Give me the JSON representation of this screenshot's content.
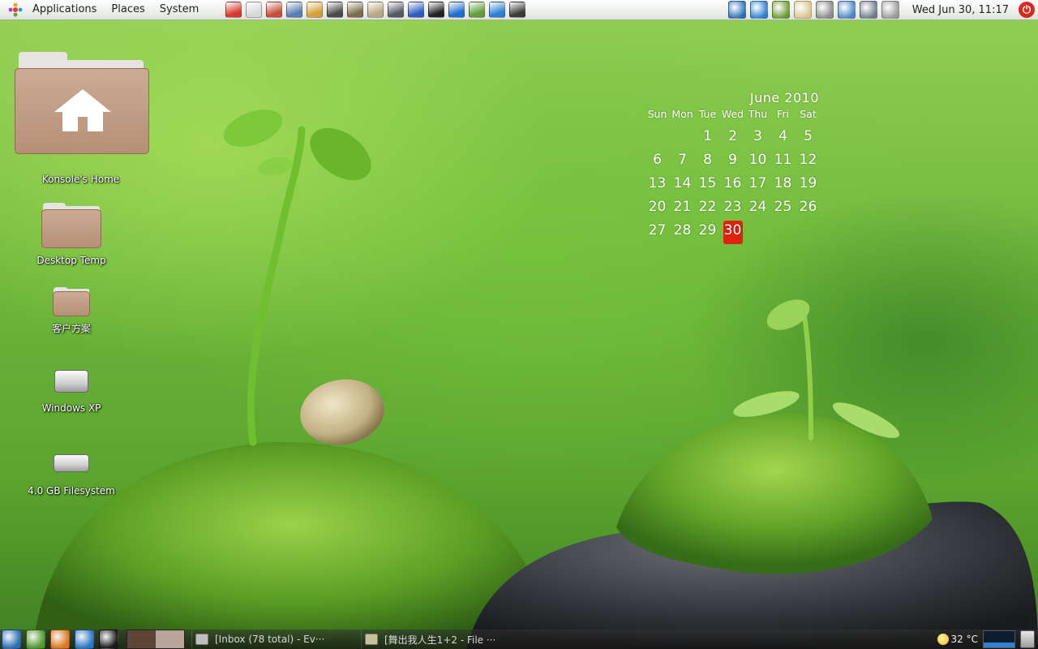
{
  "top_panel": {
    "menus": [
      "Applications",
      "Places",
      "System"
    ],
    "launcher_icons": [
      {
        "name": "mail-send-icon",
        "color": "#d63b2b"
      },
      {
        "name": "sticky-notes-icon",
        "color": "#d9d9d9"
      },
      {
        "name": "mail-client-icon",
        "color": "#c7503a"
      },
      {
        "name": "document-viewer-icon",
        "color": "#5b7db5"
      },
      {
        "name": "tools-icon",
        "color": "#d6a03a"
      },
      {
        "name": "camera-icon",
        "color": "#4a4a4a"
      },
      {
        "name": "gimp-icon",
        "color": "#7b6e4f"
      },
      {
        "name": "image-viewer-icon",
        "color": "#b9a783"
      },
      {
        "name": "calculator-icon",
        "color": "#55595f"
      },
      {
        "name": "presentation-icon",
        "color": "#2f5ec2"
      },
      {
        "name": "qq-penguin-icon",
        "color": "#222222"
      },
      {
        "name": "web-browser-globe-icon",
        "color": "#1f6fcf"
      },
      {
        "name": "network-sphere-icon",
        "color": "#5f9e3a"
      },
      {
        "name": "water-drop-icon",
        "color": "#2a7fd3"
      },
      {
        "name": "monitor-icon",
        "color": "#3b3b3b"
      }
    ],
    "tray_icons": [
      {
        "name": "download-swirl-icon",
        "color": "#2a6fb5"
      },
      {
        "name": "water-drop-tray-icon",
        "color": "#2a7fd3"
      },
      {
        "name": "globe-tray-icon",
        "color": "#6a9a2f"
      },
      {
        "name": "clipboard-icon",
        "color": "#d9c58a"
      },
      {
        "name": "volume-muted-icon",
        "color": "#8a8a8a"
      },
      {
        "name": "screenshot-icon",
        "color": "#4d86c6"
      },
      {
        "name": "network-computers-icon",
        "color": "#6e7c8a"
      },
      {
        "name": "mail-envelope-icon",
        "color": "#9a9a9a"
      }
    ],
    "clock": "Wed Jun 30, 11:17"
  },
  "desktop": {
    "icons": [
      {
        "label": "Konsole's Home",
        "kind": "home-folder"
      },
      {
        "label": "Desktop Temp",
        "kind": "folder"
      },
      {
        "label": "客户方案",
        "kind": "folder"
      },
      {
        "label": "Windows XP",
        "kind": "drive"
      },
      {
        "label": "4.0 GB Filesystem",
        "kind": "drive"
      }
    ]
  },
  "calendar": {
    "title": "June 2010",
    "weekdays": [
      "Sun",
      "Mon",
      "Tue",
      "Wed",
      "Thu",
      "Fri",
      "Sat"
    ],
    "leading_blank_days": 2,
    "days": [
      "1",
      "2",
      "3",
      "4",
      "5",
      "6",
      "7",
      "8",
      "9",
      "10",
      "11",
      "12",
      "13",
      "14",
      "15",
      "16",
      "17",
      "18",
      "19",
      "20",
      "21",
      "22",
      "23",
      "24",
      "25",
      "26",
      "27",
      "28",
      "29",
      "30"
    ],
    "today": "30",
    "today_color": "#e0220f"
  },
  "bottom_panel": {
    "launcher_icons": [
      {
        "name": "swirl-logo-icon",
        "color": "#2a6fb5"
      },
      {
        "name": "show-desktop-icon",
        "color": "#4f9a2c"
      },
      {
        "name": "firefox-icon",
        "color": "#e0761c"
      },
      {
        "name": "browser-globe-icon",
        "color": "#2b77c9"
      },
      {
        "name": "terminal-icon",
        "color": "#1c1c1c"
      }
    ],
    "workspaces": [
      {
        "color": "#5e4538"
      },
      {
        "color": "#b7a49a"
      }
    ],
    "tasks": [
      {
        "label": "[Inbox (78 total) - Ev···"
      },
      {
        "label": "[舞出我人生1+2 - File ···"
      }
    ],
    "weather_temp": "32 °C"
  }
}
